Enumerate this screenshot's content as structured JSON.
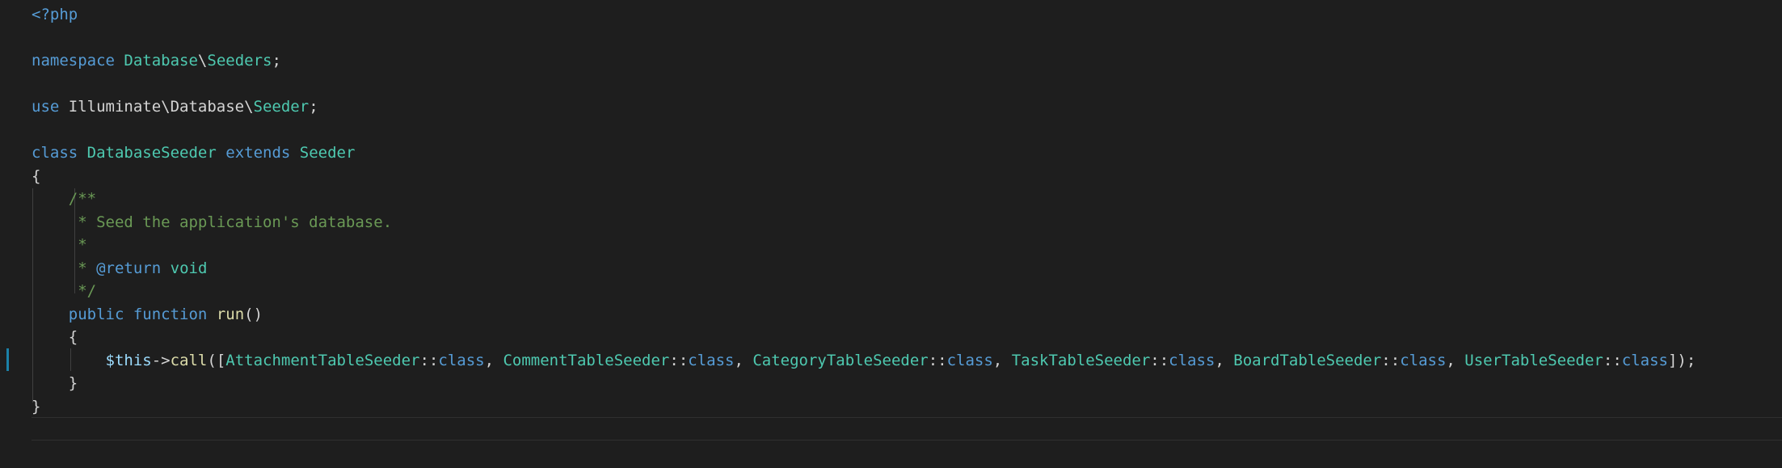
{
  "editor": {
    "lines": [
      {
        "tokens": [
          {
            "t": "<?php",
            "c": "kw"
          }
        ]
      },
      {
        "tokens": []
      },
      {
        "tokens": [
          {
            "t": "namespace",
            "c": "kw"
          },
          {
            "t": " ",
            "c": "tx"
          },
          {
            "t": "Database",
            "c": "ty"
          },
          {
            "t": "\\",
            "c": "tx"
          },
          {
            "t": "Seeders",
            "c": "ty"
          },
          {
            "t": ";",
            "c": "tx"
          }
        ]
      },
      {
        "tokens": []
      },
      {
        "tokens": [
          {
            "t": "use",
            "c": "kw"
          },
          {
            "t": " Illuminate\\Database\\",
            "c": "tx"
          },
          {
            "t": "Seeder",
            "c": "ty"
          },
          {
            "t": ";",
            "c": "tx"
          }
        ]
      },
      {
        "tokens": []
      },
      {
        "tokens": [
          {
            "t": "class",
            "c": "kw"
          },
          {
            "t": " ",
            "c": "tx"
          },
          {
            "t": "DatabaseSeeder",
            "c": "ty"
          },
          {
            "t": " ",
            "c": "tx"
          },
          {
            "t": "extends",
            "c": "kw"
          },
          {
            "t": " ",
            "c": "tx"
          },
          {
            "t": "Seeder",
            "c": "ty"
          }
        ]
      },
      {
        "tokens": [
          {
            "t": "{",
            "c": "tx"
          }
        ]
      },
      {
        "tokens": [
          {
            "t": "    ",
            "c": "tx"
          },
          {
            "t": "/**",
            "c": "cm"
          }
        ]
      },
      {
        "tokens": [
          {
            "t": "     ",
            "c": "tx"
          },
          {
            "t": "* Seed the application's database.",
            "c": "cm"
          }
        ]
      },
      {
        "tokens": [
          {
            "t": "     ",
            "c": "tx"
          },
          {
            "t": "*",
            "c": "cm"
          }
        ]
      },
      {
        "tokens": [
          {
            "t": "     ",
            "c": "tx"
          },
          {
            "t": "* ",
            "c": "cm"
          },
          {
            "t": "@return",
            "c": "cmk"
          },
          {
            "t": " ",
            "c": "cm"
          },
          {
            "t": "void",
            "c": "ty"
          }
        ]
      },
      {
        "tokens": [
          {
            "t": "     ",
            "c": "tx"
          },
          {
            "t": "*/",
            "c": "cm"
          }
        ]
      },
      {
        "tokens": [
          {
            "t": "    ",
            "c": "tx"
          },
          {
            "t": "public",
            "c": "kw"
          },
          {
            "t": " ",
            "c": "tx"
          },
          {
            "t": "function",
            "c": "kw"
          },
          {
            "t": " ",
            "c": "tx"
          },
          {
            "t": "run",
            "c": "fn"
          },
          {
            "t": "()",
            "c": "tx"
          }
        ]
      },
      {
        "tokens": [
          {
            "t": "    {",
            "c": "tx"
          }
        ]
      },
      {
        "tokens": [
          {
            "t": "        ",
            "c": "tx"
          },
          {
            "t": "$this",
            "c": "vr"
          },
          {
            "t": "->",
            "c": "tx"
          },
          {
            "t": "call",
            "c": "fn"
          },
          {
            "t": "([",
            "c": "tx"
          },
          {
            "t": "AttachmentTableSeeder",
            "c": "ty"
          },
          {
            "t": "::",
            "c": "tx"
          },
          {
            "t": "class",
            "c": "kw"
          },
          {
            "t": ", ",
            "c": "tx"
          },
          {
            "t": "CommentTableSeeder",
            "c": "ty"
          },
          {
            "t": "::",
            "c": "tx"
          },
          {
            "t": "class",
            "c": "kw"
          },
          {
            "t": ", ",
            "c": "tx"
          },
          {
            "t": "CategoryTableSeeder",
            "c": "ty"
          },
          {
            "t": "::",
            "c": "tx"
          },
          {
            "t": "class",
            "c": "kw"
          },
          {
            "t": ", ",
            "c": "tx"
          },
          {
            "t": "TaskTableSeeder",
            "c": "ty"
          },
          {
            "t": "::",
            "c": "tx"
          },
          {
            "t": "class",
            "c": "kw"
          },
          {
            "t": ", ",
            "c": "tx"
          },
          {
            "t": "BoardTableSeeder",
            "c": "ty"
          },
          {
            "t": "::",
            "c": "tx"
          },
          {
            "t": "class",
            "c": "kw"
          },
          {
            "t": ", ",
            "c": "tx"
          },
          {
            "t": "UserTableSeeder",
            "c": "ty"
          },
          {
            "t": "::",
            "c": "tx"
          },
          {
            "t": "class",
            "c": "kw"
          },
          {
            "t": "]);",
            "c": "tx"
          }
        ]
      },
      {
        "tokens": [
          {
            "t": "    }",
            "c": "tx"
          }
        ]
      },
      {
        "tokens": [
          {
            "t": "}",
            "c": "tx"
          }
        ]
      },
      {
        "tokens": []
      }
    ],
    "colors": {
      "background": "#1e1e1e",
      "keyword": "#569cd6",
      "type": "#4ec9b0",
      "function": "#dcdcaa",
      "comment": "#6a9955",
      "variable": "#9cdcfe",
      "text": "#d4d4d4",
      "modified_gutter": "#1b81a8"
    }
  }
}
